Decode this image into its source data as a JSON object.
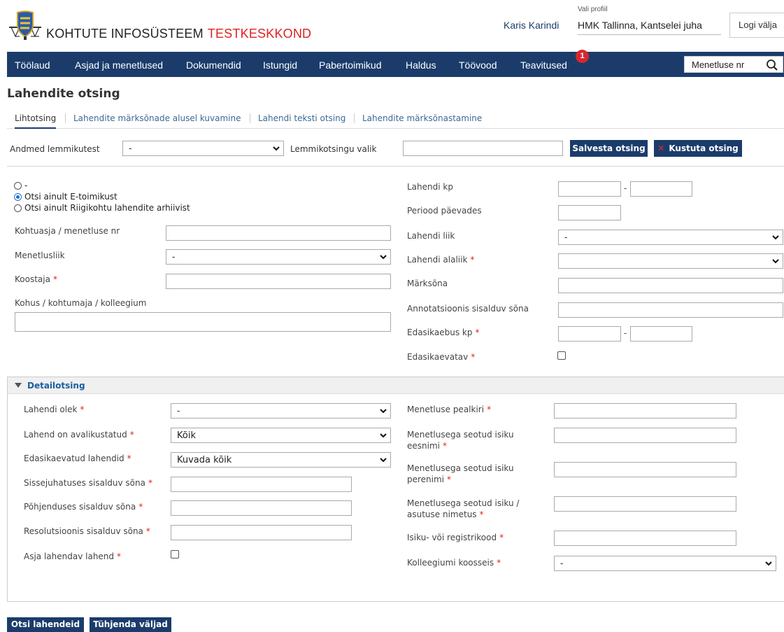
{
  "header": {
    "app_title": "KOHTUTE INFOSÜSTEEM",
    "environment": "TESTKESKKOND",
    "user_name": "Karis Karindi",
    "profile_label": "Vali profiil",
    "profile_value": "HMK Tallinna, Kantselei juha",
    "logout_label": "Logi välja"
  },
  "nav": {
    "items": [
      {
        "label": "Töölaud"
      },
      {
        "label": "Asjad ja menetlused"
      },
      {
        "label": "Dokumendid"
      },
      {
        "label": "Istungid"
      },
      {
        "label": "Pabertoimikud"
      },
      {
        "label": "Haldus"
      },
      {
        "label": "Töövood"
      },
      {
        "label": "Teavitused"
      }
    ],
    "notifications_badge": "1",
    "search_value": "Menetluse nr"
  },
  "page": {
    "title": "Lahendite otsing",
    "tabs": [
      {
        "label": "Lihtotsing",
        "active": true
      },
      {
        "label": "Lahendite märksõnade alusel kuvamine"
      },
      {
        "label": "Lahendi teksti otsing"
      },
      {
        "label": "Lahendite märksõnastamine"
      }
    ]
  },
  "favorites": {
    "label": "Andmed lemmikutest",
    "select_value": "-",
    "choice_label": "Lemmikotsingu valik",
    "choice_value": "",
    "save_label": "Salvesta otsing",
    "delete_label": "Kustuta otsing"
  },
  "form": {
    "radios": [
      {
        "label": "-",
        "checked": false
      },
      {
        "label": "Otsi ainult E-toimikust",
        "checked": true
      },
      {
        "label": "Otsi ainult Riigikohtu lahendite arhiivist",
        "checked": false
      }
    ],
    "left": {
      "case_nr_label": "Kohtuasja / menetluse nr",
      "proc_type_label": "Menetlusliik",
      "proc_type_value": "-",
      "author_label": "Koostaja",
      "court_label": "Kohus / kohtumaja / kolleegium"
    },
    "right": {
      "date_label": "Lahendi kp",
      "period_label": "Periood päevades",
      "type_label": "Lahendi liik",
      "type_value": "-",
      "subtype_label": "Lahendi alaliik",
      "subtype_value": "",
      "keyword_label": "Märksõna",
      "annotation_label": "Annotatsioonis sisalduv sõna",
      "appeal_date_label": "Edasikaebus kp",
      "appealable_label": "Edasikaevatav",
      "range_sep": "-"
    },
    "required_mark": "*"
  },
  "detail": {
    "title": "Detailotsing",
    "left": {
      "status_label": "Lahendi olek",
      "status_value": "-",
      "published_label": "Lahend on avalikustatud",
      "published_value": "Kõik",
      "appealed_label": "Edasikaevatud lahendid",
      "appealed_value": "Kuvada kõik",
      "intro_label": "Sissejuhatuses sisalduv sõna",
      "reasoning_label": "Põhjenduses sisalduv sõna",
      "resolution_label": "Resolutsioonis sisalduv sõna",
      "resolving_label": "Asja lahendav lahend"
    },
    "right": {
      "proc_title_label": "Menetluse pealkiri",
      "first_name_label_1": "Menetlusega seotud isiku",
      "first_name_label_2": "eesnimi",
      "last_name_label_1": "Menetlusega seotud isiku",
      "last_name_label_2": "perenimi",
      "org_label_1": "Menetlusega seotud isiku /",
      "org_label_2": "asutuse nimetus",
      "code_label": "Isiku- või registrikood",
      "panel_label": "Kolleegiumi koosseis",
      "panel_value": "-"
    }
  },
  "actions": {
    "search_label": "Otsi lahendeid",
    "clear_label": "Tühjenda väljad"
  },
  "colors": {
    "primary": "#1b3c6b",
    "accent_red": "#e02020",
    "link": "#3a6a95"
  }
}
